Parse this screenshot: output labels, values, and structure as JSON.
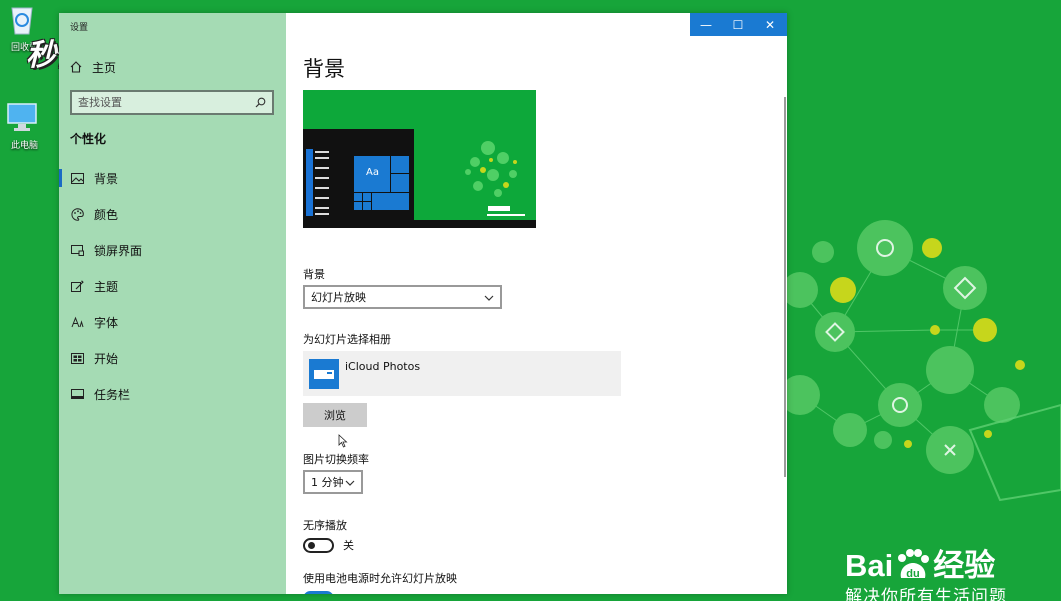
{
  "desktop": {
    "icons": [
      {
        "label": "回收站"
      },
      {
        "label": "此电脑"
      }
    ],
    "watermark_top": "秒懂视频",
    "watermark_bottom": {
      "logo": "Bai",
      "logo_suffix": "经验",
      "slogan": "解决你所有生活问题"
    }
  },
  "window": {
    "app_title": "设置",
    "home_label": "主页",
    "search_placeholder": "查找设置",
    "section_title": "个性化",
    "nav": [
      {
        "label": "背景",
        "icon": "picture-icon"
      },
      {
        "label": "颜色",
        "icon": "palette-icon"
      },
      {
        "label": "锁屏界面",
        "icon": "lock-screen-icon"
      },
      {
        "label": "主题",
        "icon": "theme-icon"
      },
      {
        "label": "字体",
        "icon": "font-icon"
      },
      {
        "label": "开始",
        "icon": "start-icon"
      },
      {
        "label": "任务栏",
        "icon": "taskbar-icon"
      }
    ],
    "titlebar": {
      "minimize": "—",
      "maximize": "☐",
      "close": "✕"
    },
    "preview_tile_text": "Aa",
    "page_title": "背景",
    "background_label": "背景",
    "background_value": "幻灯片放映",
    "album_label": "为幻灯片选择相册",
    "album_name": "iCloud Photos",
    "browse_label": "浏览",
    "interval_label": "图片切换频率",
    "interval_value": "1 分钟",
    "shuffle_label": "无序播放",
    "shuffle_state": "关",
    "battery_label": "使用电池电源时允许幻灯片放映"
  }
}
